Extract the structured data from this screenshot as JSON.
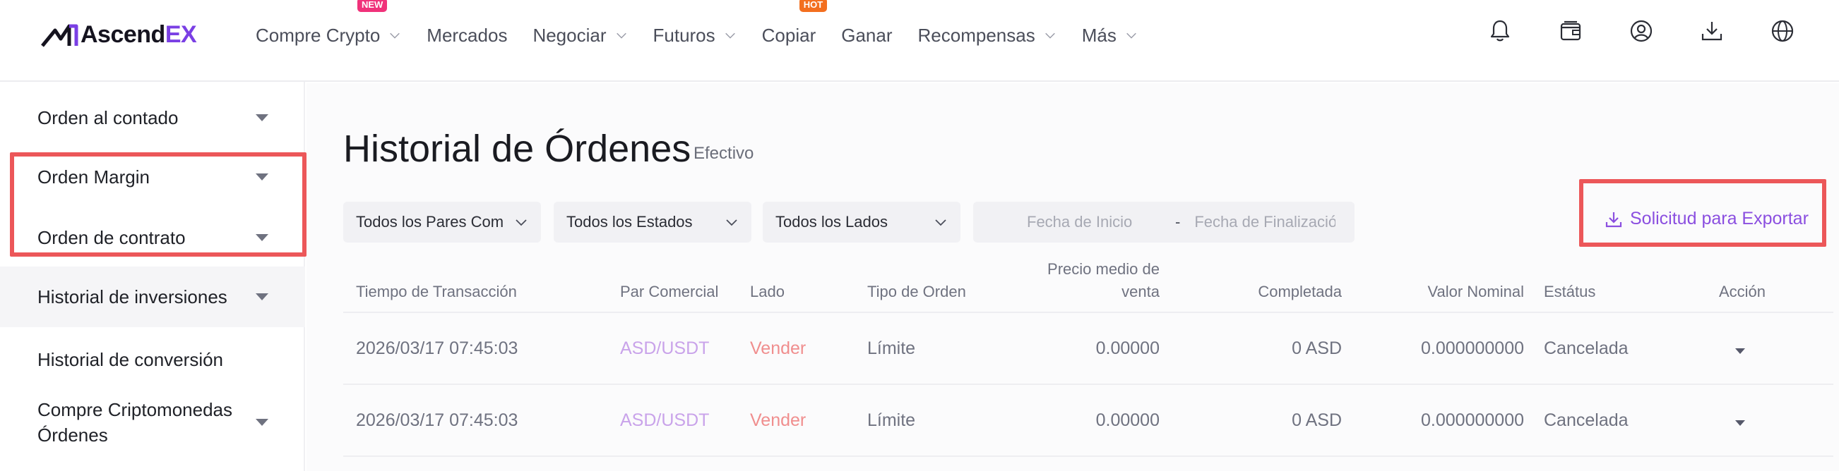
{
  "header": {
    "logo_text_main": "Ascend",
    "logo_text_accent": "EX",
    "nav": [
      {
        "label": "Compre Crypto",
        "badge": "NEW",
        "has_chevron": true
      },
      {
        "label": "Mercados",
        "has_chevron": false
      },
      {
        "label": "Negociar",
        "has_chevron": true
      },
      {
        "label": "Futuros",
        "has_chevron": true
      },
      {
        "label": "Copiar",
        "badge": "HOT",
        "has_chevron": false
      },
      {
        "label": "Ganar",
        "has_chevron": false
      },
      {
        "label": "Recompensas",
        "has_chevron": true
      },
      {
        "label": "Más",
        "has_chevron": true
      }
    ],
    "icons": [
      "bell-icon",
      "wallet-icon",
      "user-icon",
      "download-icon",
      "globe-icon"
    ]
  },
  "sidebar": {
    "items": [
      {
        "label": "Orden al contado"
      },
      {
        "label": "Orden Margin"
      },
      {
        "label": "Orden de contrato"
      },
      {
        "label": "Historial de inversiones"
      },
      {
        "label": "Historial de conversión"
      },
      {
        "label": "Compre Criptomonedas Órdenes"
      }
    ]
  },
  "main": {
    "title": "Historial de Órdenes",
    "subtitle": "Efectivo",
    "filters": {
      "pairs": "Todos los Pares Com",
      "states": "Todos los Estados",
      "sides": "Todos los Lados",
      "start_placeholder": "Fecha de Inicio",
      "separator": "-",
      "end_placeholder": "Fecha de Finalizació"
    },
    "export_label": "Solicitud para Exportar",
    "table": {
      "headers": {
        "time": "Tiempo de Transacción",
        "pair": "Par Comercial",
        "side": "Lado",
        "type": "Tipo de Orden",
        "avg_price_1": "Precio medio de",
        "avg_price_2": "venta",
        "filled": "Completada",
        "notional": "Valor Nominal",
        "status": "Estátus",
        "action": "Acción"
      },
      "rows": [
        {
          "time": "2026/03/17 07:45:03",
          "pair": "ASD/USDT",
          "side": "Vender",
          "type": "Límite",
          "avg_price": "0.00000",
          "filled": "0 ASD",
          "notional": "0.000000000",
          "status": "Cancelada"
        },
        {
          "time": "2026/03/17 07:45:03",
          "pair": "ASD/USDT",
          "side": "Vender",
          "type": "Límite",
          "avg_price": "0.00000",
          "filled": "0 ASD",
          "notional": "0.000000000",
          "status": "Cancelada"
        }
      ]
    }
  },
  "colors": {
    "brand_purple": "#7a3fe4",
    "export_purple": "#8b4fe0",
    "pair_text": "#c9a3ea",
    "sell_text": "#f08e8e",
    "highlight_red": "#ec5759",
    "badge_new": "#f0327a",
    "badge_hot": "#f36f1f"
  }
}
